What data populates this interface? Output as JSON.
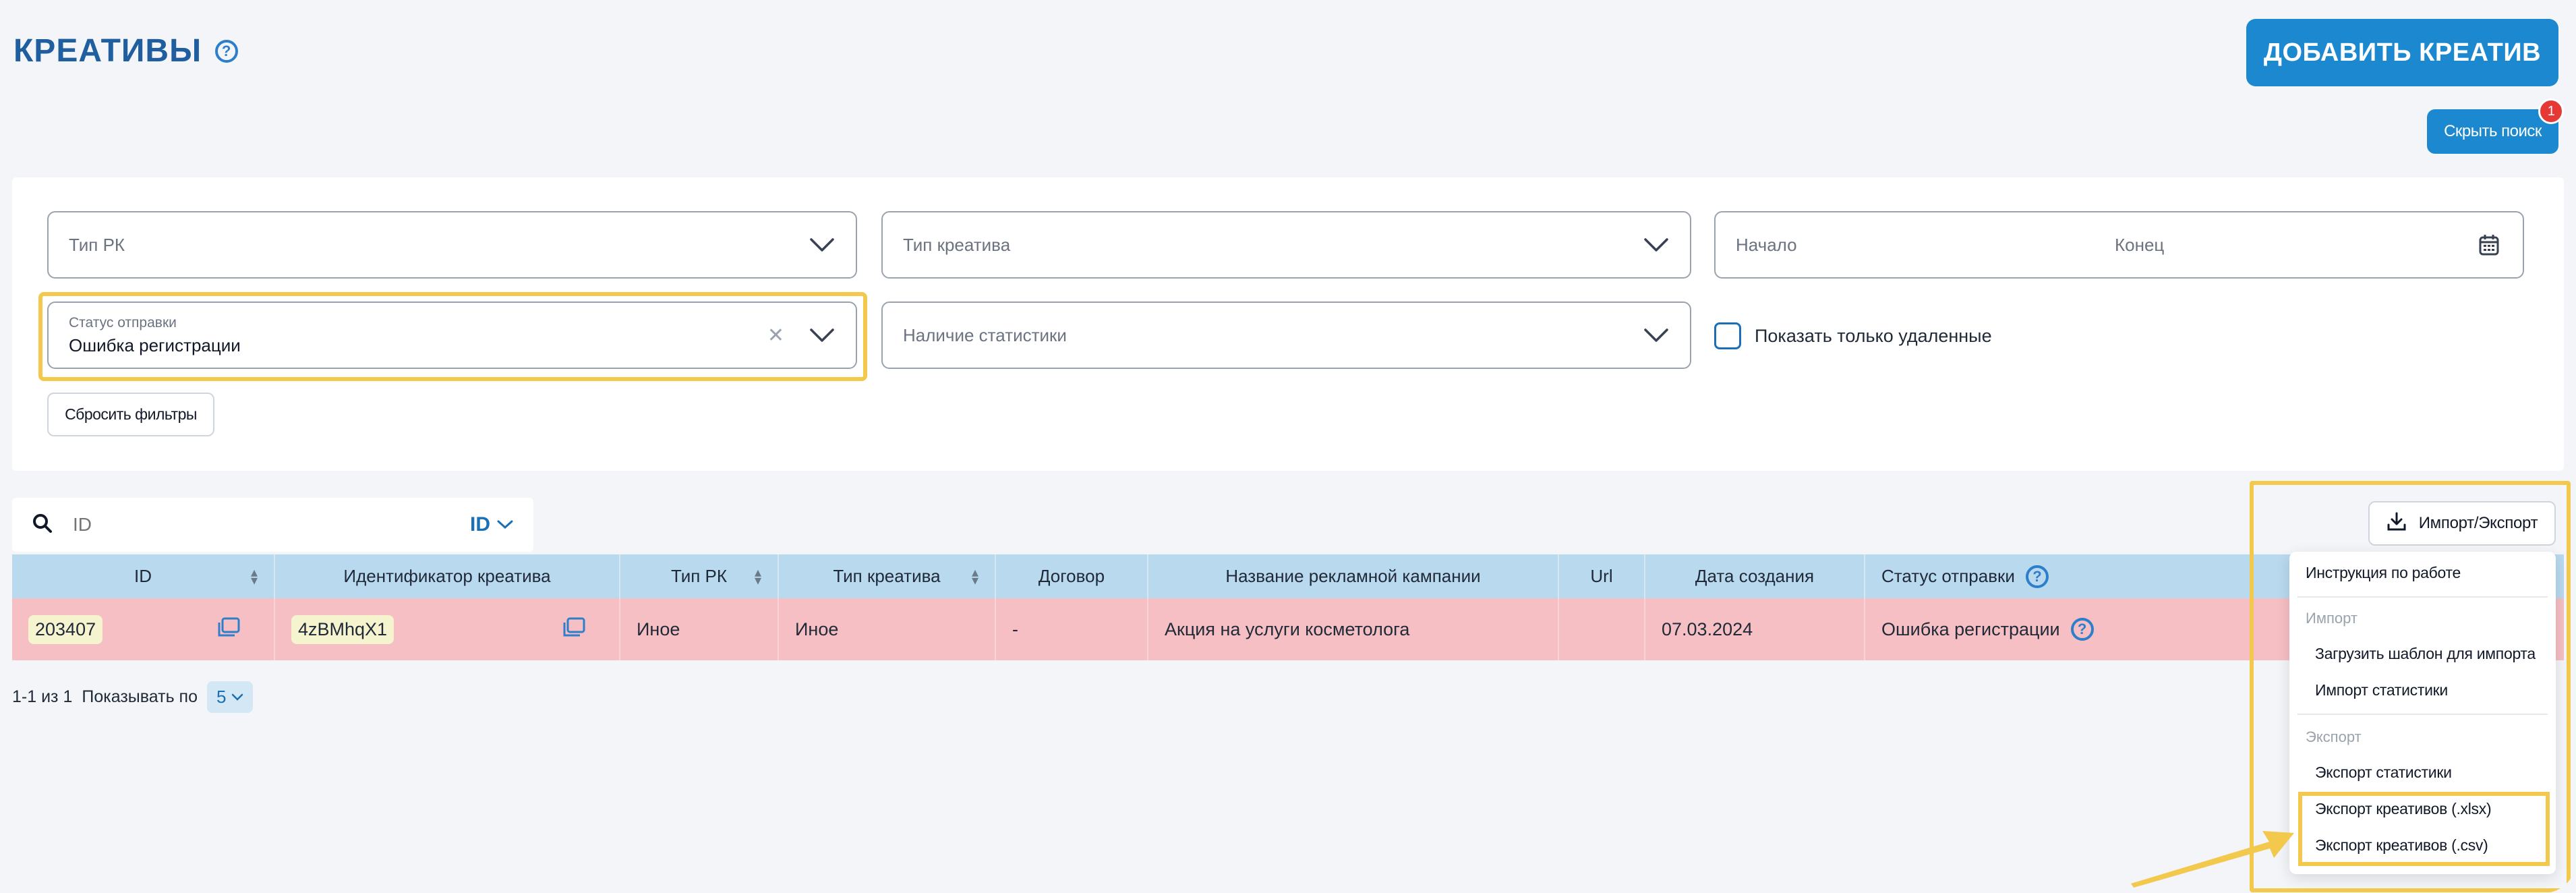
{
  "header": {
    "title": "КРЕАТИВЫ",
    "help_icon": "question-circle-icon",
    "add_button": "ДОБАВИТЬ КРЕАТИВ",
    "hide_search_button": "Скрыть поиск",
    "hide_search_badge": "1"
  },
  "filters": {
    "campaign_type_placeholder": "Тип РК",
    "creative_type_placeholder": "Тип креатива",
    "date_start_placeholder": "Начало",
    "date_end_placeholder": "Конец",
    "send_status_label": "Статус отправки",
    "send_status_value": "Ошибка регистрации",
    "stats_presence_placeholder": "Наличие статистики",
    "show_deleted_label": "Показать только удаленные",
    "show_deleted_checked": false,
    "reset_button": "Сбросить фильтры"
  },
  "search": {
    "placeholder": "ID",
    "type_selected": "ID"
  },
  "import_export": {
    "button": "Импорт/Экспорт",
    "menu": {
      "instructions": "Инструкция по работе",
      "import_section": "Импорт",
      "upload_template": "Загрузить шаблон для импорта",
      "import_stats": "Импорт статистики",
      "export_section": "Экспорт",
      "export_stats": "Экспорт статистики",
      "export_xlsx": "Экспорт креативов (.xlsx)",
      "export_csv": "Экспорт креативов (.csv)"
    }
  },
  "table": {
    "columns": [
      "ID",
      "Идентификатор креатива",
      "Тип РК",
      "Тип креатива",
      "Договор",
      "Название рекламной кампании",
      "Url",
      "Дата создания",
      "Статус отправки"
    ],
    "rows": [
      {
        "id": "203407",
        "creative_identifier": "4zBMhqX1",
        "campaign_type": "Иное",
        "creative_type": "Иное",
        "contract": "-",
        "campaign_name": "Акция на услуги косметолога",
        "url": "",
        "created_date": "07.03.2024",
        "send_status": "Ошибка регистрации"
      }
    ]
  },
  "pagination": {
    "range_text": "1-1 из 1",
    "per_page_label": "Показывать по",
    "per_page_value": "5"
  },
  "colors": {
    "accent": "#1b88cf",
    "error_row": "#f5bfc3",
    "header_row": "#b9d9ef",
    "highlight": "#f2c94c"
  }
}
